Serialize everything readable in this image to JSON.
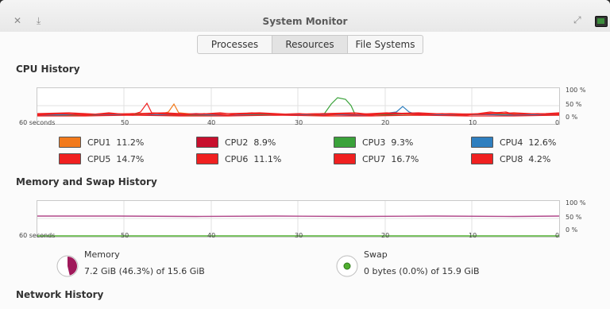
{
  "window": {
    "title": "System Monitor"
  },
  "tabs": [
    {
      "label": "Processes"
    },
    {
      "label": "Resources"
    },
    {
      "label": "File Systems"
    }
  ],
  "cpu": {
    "title": "CPU History",
    "axis": [
      "60 seconds",
      "50",
      "40",
      "30",
      "20",
      "10",
      "0"
    ],
    "pct": [
      "100 %",
      "50 %",
      "0 %"
    ],
    "items": [
      {
        "label": "CPU1",
        "value": "11.2%",
        "color": "#f27a1c"
      },
      {
        "label": "CPU2",
        "value": "8.9%",
        "color": "#c8102e"
      },
      {
        "label": "CPU3",
        "value": "9.3%",
        "color": "#3aa23a"
      },
      {
        "label": "CPU4",
        "value": "12.6%",
        "color": "#2f7fbf"
      },
      {
        "label": "CPU5",
        "value": "14.7%",
        "color": "#f02020"
      },
      {
        "label": "CPU6",
        "value": "11.1%",
        "color": "#f02020"
      },
      {
        "label": "CPU7",
        "value": "16.7%",
        "color": "#f02020"
      },
      {
        "label": "CPU8",
        "value": "4.2%",
        "color": "#f02020"
      }
    ]
  },
  "memory": {
    "title": "Memory and Swap History",
    "axis": [
      "60 seconds",
      "50",
      "40",
      "30",
      "20",
      "10",
      "0"
    ],
    "pct": [
      "100 %",
      "50 %",
      "0 %"
    ],
    "memory_label": "Memory",
    "memory_detail": "7.2 GiB (46.3%) of 15.6 GiB",
    "memory_fraction": 0.463,
    "memory_color": "#a0195b",
    "swap_label": "Swap",
    "swap_detail": "0 bytes (0.0%) of 15.9 GiB",
    "swap_fraction": 0.0,
    "swap_color": "#4fae2f"
  },
  "network": {
    "title": "Network History"
  }
}
